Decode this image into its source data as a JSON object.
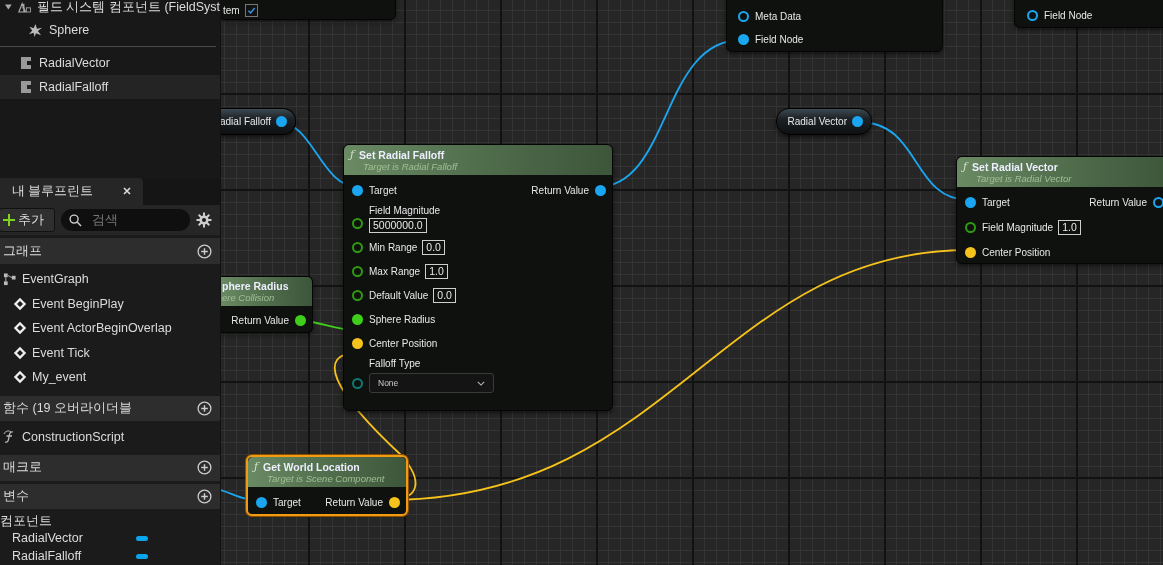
{
  "outline": {
    "root": {
      "label": "필드 시스템 컴포넌트 (FieldSyst",
      "expanded": true,
      "children": [
        {
          "label": "Sphere"
        }
      ]
    },
    "items": [
      {
        "label": "RadialVector",
        "selected": false
      },
      {
        "label": "RadialFalloff",
        "selected": true
      }
    ]
  },
  "my_blueprint": {
    "tab": "내 블루프린트",
    "add_label": "추가",
    "search_placeholder": "검색",
    "sections": [
      {
        "title": "그래프",
        "items": [
          {
            "label": "EventGraph",
            "kind": "graph",
            "children": [
              {
                "label": "Event BeginPlay",
                "kind": "event"
              },
              {
                "label": "Event ActorBeginOverlap",
                "kind": "event"
              },
              {
                "label": "Event Tick",
                "kind": "event"
              },
              {
                "label": "My_event",
                "kind": "event"
              }
            ]
          }
        ]
      },
      {
        "title": "함수 (19 오버라이더블",
        "items": [
          {
            "label": "ConstructionScript",
            "kind": "function"
          }
        ]
      },
      {
        "title": "매크로"
      },
      {
        "title": "변수",
        "categories": [
          {
            "title": "컴포넌트",
            "variables": [
              {
                "name": "RadialVector",
                "color": "#0aa5ef"
              },
              {
                "name": "RadialFalloff",
                "color": "#0aa5ef"
              }
            ]
          }
        ]
      }
    ]
  },
  "graph": {
    "nodes": [
      {
        "kind": "stub",
        "inputs": [
          {
            "label": "tem",
            "checked": true
          }
        ]
      },
      {
        "kind": "stub",
        "inputs": [
          {
            "label": "Meta Data",
            "color": "#1aa6f0",
            "connected": false
          },
          {
            "label": "Field Node",
            "color": "#1aa6f0",
            "connected": true
          }
        ]
      },
      {
        "kind": "stub",
        "inputs": [
          {
            "label": "Field Node",
            "color": "#1aa6f0",
            "connected": false
          }
        ]
      },
      {
        "kind": "getter",
        "title": "adial Falloff",
        "clipped": true,
        "outputs": [
          {
            "color": "#1aa6f0",
            "connected": true
          }
        ]
      },
      {
        "kind": "getter",
        "title": "Radial Vector",
        "clipped": false,
        "outputs": [
          {
            "color": "#1aa6f0",
            "connected": true
          }
        ]
      },
      {
        "kind": "function",
        "icon": "ƒ",
        "title": "Set Radial Falloff",
        "subtitle": "Target is Radial Falloff",
        "clipped": false,
        "selected": false,
        "inputs": [
          {
            "label": "Target",
            "color": "#1aa6f0",
            "connected": true,
            "stacked": false
          },
          {
            "label": "Field Magnitude",
            "color": "#2f9a12",
            "connected": false,
            "value": "5000000.0",
            "stacked": true
          },
          {
            "label": "Min Range",
            "color": "#2f9a12",
            "connected": false,
            "value": "0.0",
            "stacked": false
          },
          {
            "label": "Max Range",
            "color": "#2f9a12",
            "connected": false,
            "value": "1.0",
            "stacked": false
          },
          {
            "label": "Default Value",
            "color": "#2f9a12",
            "connected": false,
            "value": "0.0",
            "stacked": false
          },
          {
            "label": "Sphere Radius",
            "color": "#3fcf1a",
            "connected": true,
            "stacked": false
          },
          {
            "label": "Center Position",
            "color": "#f6c21c",
            "connected": true,
            "stacked": false
          },
          {
            "label": "Falloff Type",
            "color": "#0e7a72",
            "connected": false,
            "option": "None",
            "stacked": true
          }
        ],
        "outputs": [
          {
            "label": "Return Value",
            "color": "#1aa6f0",
            "connected": true
          }
        ]
      },
      {
        "kind": "function",
        "title": "phere Radius",
        "subtitle": "ere Collision",
        "clipped": true,
        "selected": false,
        "outputs": [
          {
            "label": "Return Value",
            "color": "#3fcf1a",
            "connected": true
          }
        ]
      },
      {
        "kind": "function",
        "icon": "ƒ",
        "title": "Set Radial Vector",
        "subtitle": "Target is Radial Vector",
        "clipped": false,
        "selected": false,
        "inputs": [
          {
            "label": "Target",
            "color": "#1aa6f0",
            "connected": true
          },
          {
            "label": "Field Magnitude",
            "color": "#2f9a12",
            "connected": false,
            "value": "1.0"
          },
          {
            "label": "Center Position",
            "color": "#f6c21c",
            "connected": true
          }
        ],
        "outputs": [
          {
            "label": "Return Value",
            "color": "#1aa6f0",
            "connected": false
          }
        ]
      },
      {
        "kind": "function",
        "icon": "ƒ",
        "title": "Get World Location",
        "subtitle": "Target is Scene Component",
        "clipped": false,
        "selected": true,
        "inputs": [
          {
            "label": "Target",
            "color": "#1aa6f0",
            "connected": true
          }
        ],
        "outputs": [
          {
            "label": "Return Value",
            "color": "#f6c21c",
            "connected": true
          }
        ]
      }
    ]
  }
}
